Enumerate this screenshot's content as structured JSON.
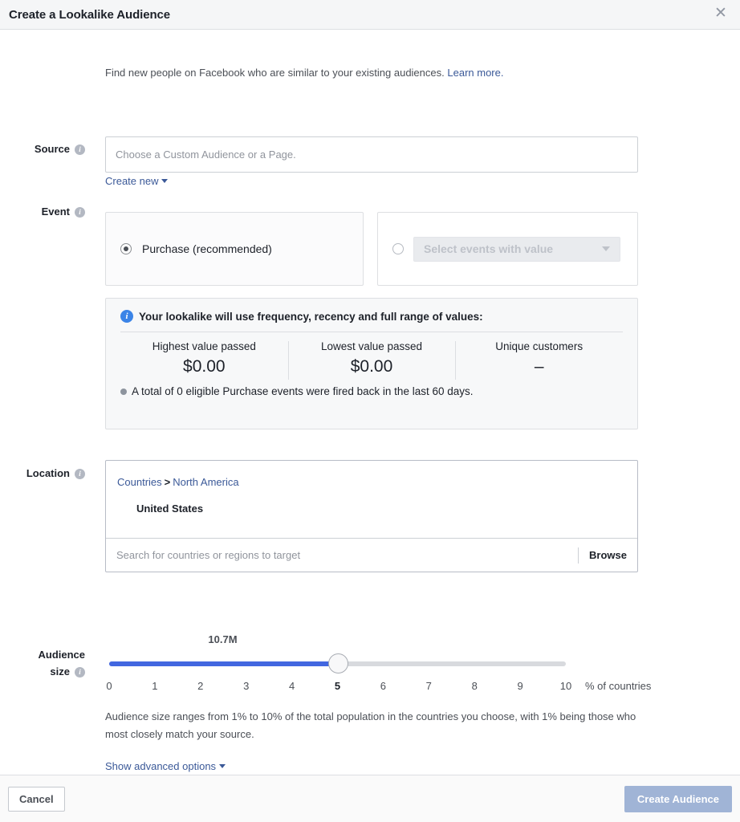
{
  "header": {
    "title": "Create a Lookalike Audience",
    "close_icon": "close-icon",
    "close_glyph": "✕"
  },
  "intro": {
    "text": "Find new people on Facebook who are similar to your existing audiences.",
    "link": "Learn more."
  },
  "source": {
    "label": "Source",
    "info_icon": "info-icon",
    "placeholder": "Choose a Custom Audience or a Page.",
    "value": "",
    "create_new": "Create new"
  },
  "event": {
    "label": "Event",
    "info_icon": "info-icon",
    "option_purchase": "Purchase (recommended)",
    "purchase_selected": true,
    "option_value_events": "Select events with value",
    "value_events_selected": false,
    "value_events_disabled": true
  },
  "info_panel": {
    "icon": "info-circle-icon",
    "heading": "Your lookalike will use frequency, recency and full range of values:",
    "stats": [
      {
        "label": "Highest value passed",
        "value": "$0.00"
      },
      {
        "label": "Lowest value passed",
        "value": "$0.00"
      },
      {
        "label": "Unique customers",
        "value": "–"
      }
    ],
    "footnote": "A total of 0 eligible Purchase events were fired back in the last 60 days."
  },
  "location": {
    "label": "Location",
    "info_icon": "info-icon",
    "breadcrumb_root": "Countries",
    "breadcrumb_sep": ">",
    "breadcrumb_current": "North America",
    "selected": "United States",
    "search_placeholder": "Search for countries or regions to target",
    "search_value": "",
    "browse": "Browse"
  },
  "audience_size": {
    "label_line1": "Audience",
    "label_line2": "size",
    "info_icon": "info-icon",
    "estimate": "10.7M",
    "value": 5,
    "min": 0,
    "max": 10,
    "ticks": [
      "0",
      "1",
      "2",
      "3",
      "4",
      "5",
      "6",
      "7",
      "8",
      "9",
      "10"
    ],
    "suffix": "% of countries",
    "description": "Audience size ranges from 1% to 10% of the total population in the countries you choose, with 1% being those who most closely match your source.",
    "advanced_options": "Show advanced options"
  },
  "footer": {
    "cancel": "Cancel",
    "submit": "Create Audience",
    "submit_disabled": true
  },
  "colors": {
    "accent_blue": "#4267e0",
    "link_blue": "#3b5998",
    "info_blue": "#3b84e7",
    "primary_disabled": "#a0b4d6",
    "header_bg": "#f5f6f7",
    "panel_bg": "#f7f8f9"
  }
}
